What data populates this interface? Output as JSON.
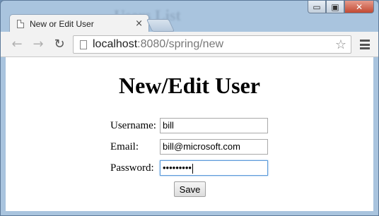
{
  "window": {
    "background_page_title": "Users List",
    "controls": {
      "minimize": "▭",
      "maximize": "▣",
      "close": "✕"
    }
  },
  "tab": {
    "title": "New or Edit User",
    "close_glyph": "×"
  },
  "toolbar": {
    "back_glyph": "←",
    "forward_glyph": "→",
    "reload_glyph": "↻",
    "url_host": "localhost",
    "url_path": ":8080/spring/new",
    "star_glyph": "☆"
  },
  "form": {
    "heading": "New/Edit User",
    "username_label": "Username:",
    "username_value": "bill",
    "email_label": "Email:",
    "email_value": "bill@microsoft.com",
    "password_label": "Password:",
    "password_masked": "•••••••••",
    "save_label": "Save"
  },
  "colors": {
    "window_frame": "#a9c4de",
    "focus_border": "#5b9ad9",
    "close_button": "#c24a33"
  }
}
